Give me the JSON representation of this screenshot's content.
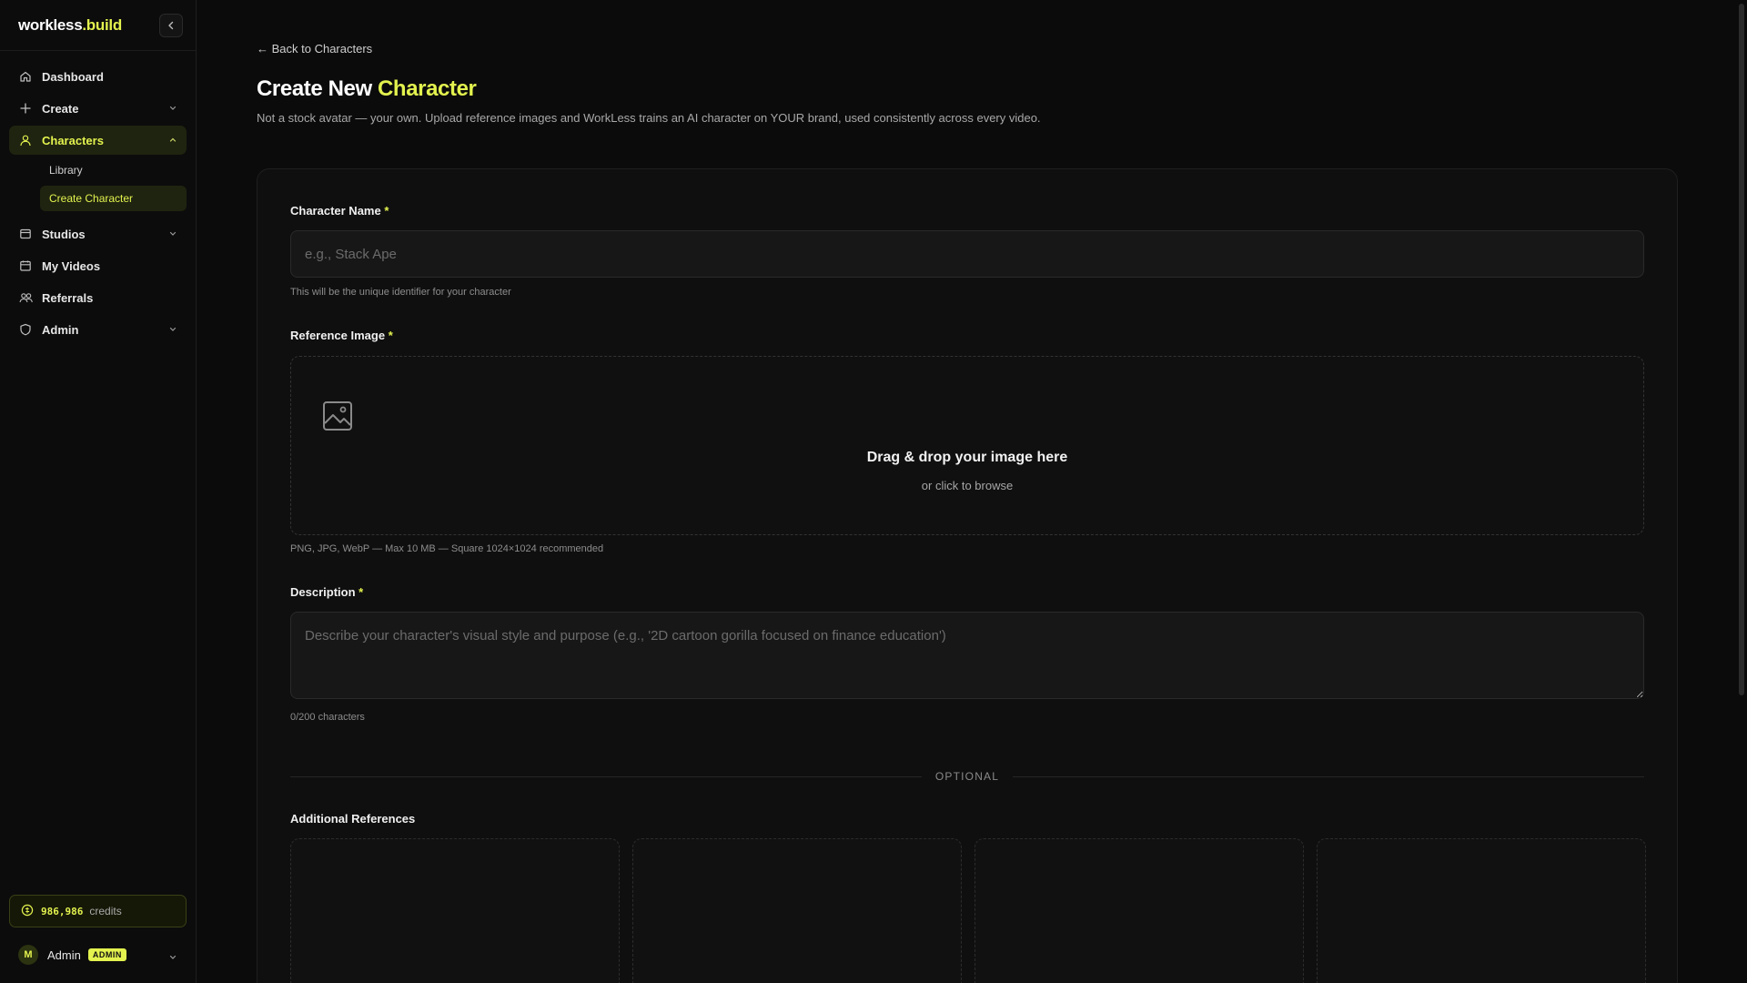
{
  "brand": {
    "name_part1": "workless",
    "name_part2": ".build"
  },
  "sidebar": {
    "items": [
      {
        "label": "Dashboard",
        "icon": "home-icon"
      },
      {
        "label": "Create",
        "icon": "plus-icon"
      },
      {
        "label": "Characters",
        "icon": "user-icon"
      },
      {
        "label": "Studios",
        "icon": "studio-icon"
      },
      {
        "label": "My Videos",
        "icon": "calendar-icon"
      },
      {
        "label": "Referrals",
        "icon": "users-icon"
      },
      {
        "label": "Admin",
        "icon": "shield-icon"
      }
    ],
    "characters_sub": [
      {
        "label": "Library"
      },
      {
        "label": "Create Character"
      }
    ],
    "credits": {
      "value": "986,986",
      "unit": "credits"
    },
    "user": {
      "initial": "M",
      "name": "Admin",
      "role": "ADMIN"
    }
  },
  "main": {
    "back_link": "← Back to Characters",
    "title_part1": "Create New ",
    "title_part2": "Character",
    "subtitle": "Not a stock avatar — your own. Upload reference images and WorkLess trains an AI character on YOUR brand, used consistently across every video.",
    "form": {
      "name_label": "Character Name",
      "required_mark": "*",
      "name_placeholder": "e.g., Stack Ape",
      "name_help": "This will be the unique identifier for your character",
      "image_label": "Reference Image",
      "dropzone_title": "Drag & drop your image here",
      "dropzone_sub": "or click to browse",
      "image_help": "PNG, JPG, WebP — Max 10 MB — Square 1024×1024 recommended",
      "desc_label": "Description",
      "desc_placeholder": "Describe your character's visual style and purpose (e.g., '2D cartoon gorilla focused on finance education')",
      "desc_counter": "0/200 characters",
      "divider_text": "OPTIONAL",
      "additional_label": "Additional References"
    }
  },
  "colors": {
    "accent": "#e3f24e",
    "background": "#0b0b0b",
    "card": "#0f0f0f"
  }
}
